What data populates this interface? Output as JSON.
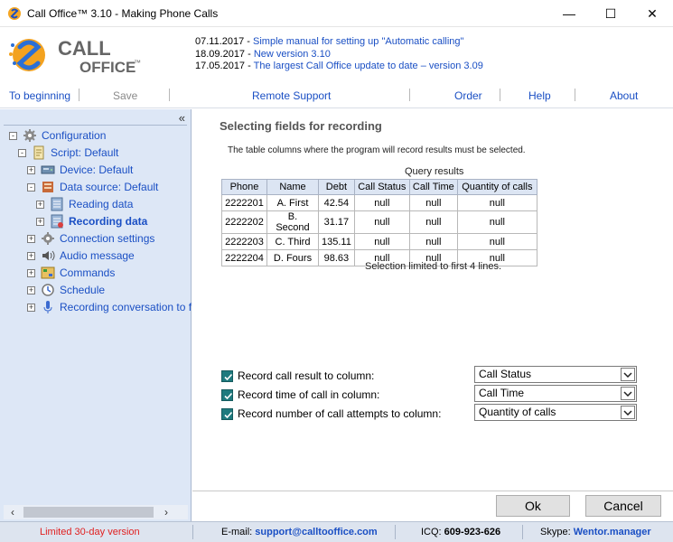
{
  "window": {
    "title": "Call Office™ 3.10 - Making Phone Calls",
    "minimize": "—",
    "maximize": "☐",
    "close": "✕"
  },
  "logo": {
    "line1": "CALL",
    "line2": "OFFICE",
    "mark": "™"
  },
  "news": [
    {
      "date": "07.11.2017 - ",
      "text": "Simple manual for setting up \"Automatic calling\""
    },
    {
      "date": "18.09.2017 - ",
      "text": "New version 3.10"
    },
    {
      "date": "17.05.2017 - ",
      "text": "The largest Call Office update to date – version 3.09"
    }
  ],
  "toolbar": {
    "to_beginning": "To beginning",
    "save": "Save",
    "remote_support": "Remote Support",
    "order": "Order",
    "help": "Help",
    "about": "About"
  },
  "tree": {
    "collapse": "«",
    "items": [
      {
        "label": "Configuration",
        "icon": "gear-icon"
      },
      {
        "label": "Script: Default",
        "icon": "script-icon"
      },
      {
        "label": "Device: Default",
        "icon": "device-icon"
      },
      {
        "label": "Data source: Default",
        "icon": "database-icon"
      },
      {
        "label": "Reading data",
        "icon": "reading-data-icon"
      },
      {
        "label": "Recording data",
        "icon": "recording-data-icon"
      },
      {
        "label": "Connection settings",
        "icon": "gear-icon"
      },
      {
        "label": "Audio message",
        "icon": "speaker-icon"
      },
      {
        "label": "Commands",
        "icon": "commands-icon"
      },
      {
        "label": "Schedule",
        "icon": "clock-icon"
      },
      {
        "label": "Recording conversation to f",
        "icon": "microphone-icon"
      }
    ]
  },
  "main": {
    "section_title": "Selecting fields for recording",
    "description": "The table columns where the program will record results must be selected.",
    "caption": "Query results",
    "columns": [
      "Phone",
      "Name",
      "Debt",
      "Call Status",
      "Call Time",
      "Quantity of calls"
    ],
    "rows": [
      [
        "2222201",
        "A. First",
        "42.54",
        "null",
        "null",
        "null"
      ],
      [
        "2222202",
        "B. Second",
        "31.17",
        "null",
        "null",
        "null"
      ],
      [
        "2222203",
        "C. Third",
        "135.11",
        "null",
        "null",
        "null"
      ],
      [
        "2222204",
        "D. Fours",
        "98.63",
        "null",
        "null",
        "null"
      ]
    ],
    "limit_note": "Selection limited to first 4 lines.",
    "options": [
      {
        "label": "Record call result to column:",
        "value": "Call Status",
        "checked": true
      },
      {
        "label": "Record time of call in column:",
        "value": "Call Time",
        "checked": true
      },
      {
        "label": "Record number of call attempts to column:",
        "value": "Quantity of calls",
        "checked": true
      }
    ],
    "ok": "Ok",
    "cancel": "Cancel"
  },
  "status": {
    "limited": "Limited 30-day version",
    "email_label": "E-mail: ",
    "email": "support@calltooffice.com",
    "icq_label": "ICQ: ",
    "icq": "609-923-626",
    "skype_label": "Skype: ",
    "skype": "Wentor.manager"
  },
  "colors": {
    "accent": "#1a4fc4",
    "tree_bg": "#dde7f6",
    "checkbox": "#1e7a7e",
    "warning": "#e02020"
  }
}
